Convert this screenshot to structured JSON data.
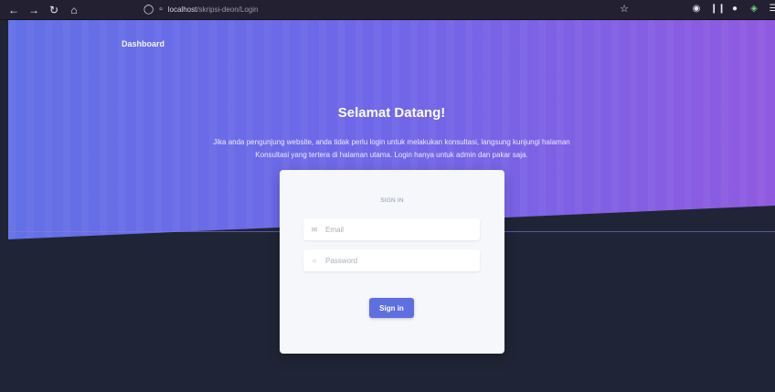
{
  "browser": {
    "url_host": "localhost",
    "url_path": "/skripsi-deon/Login",
    "icons": {
      "back": "back-arrow-icon",
      "forward": "forward-arrow-icon",
      "reload": "reload-icon",
      "home": "home-icon",
      "shield": "shield-icon",
      "page": "page-icon",
      "bookmark": "bookmark-star-icon",
      "pocket": "pocket-icon",
      "library": "library-icon",
      "account": "account-icon",
      "extension": "extension-icon",
      "menu": "menu-icon"
    }
  },
  "page": {
    "brand": "Dashboard",
    "hero": {
      "title": "Selamat Datang!",
      "intro": "Jika anda pengunjung website, anda tidak perlu login untuk melakukan konsultasi, langsung kunjungi halaman Konsultasi yang tertera di halaman utama. Login hanya untuk admin dan pakar saja."
    },
    "login": {
      "heading": "SIGN IN",
      "email_placeholder": "Email",
      "password_placeholder": "Password",
      "submit_label": "Sign in"
    },
    "colors": {
      "accent": "#5F6FE0",
      "hero_start": "#6470E6",
      "hero_end": "#8F5AE0",
      "background": "#1F2536",
      "card": "#F5F7FB"
    }
  }
}
